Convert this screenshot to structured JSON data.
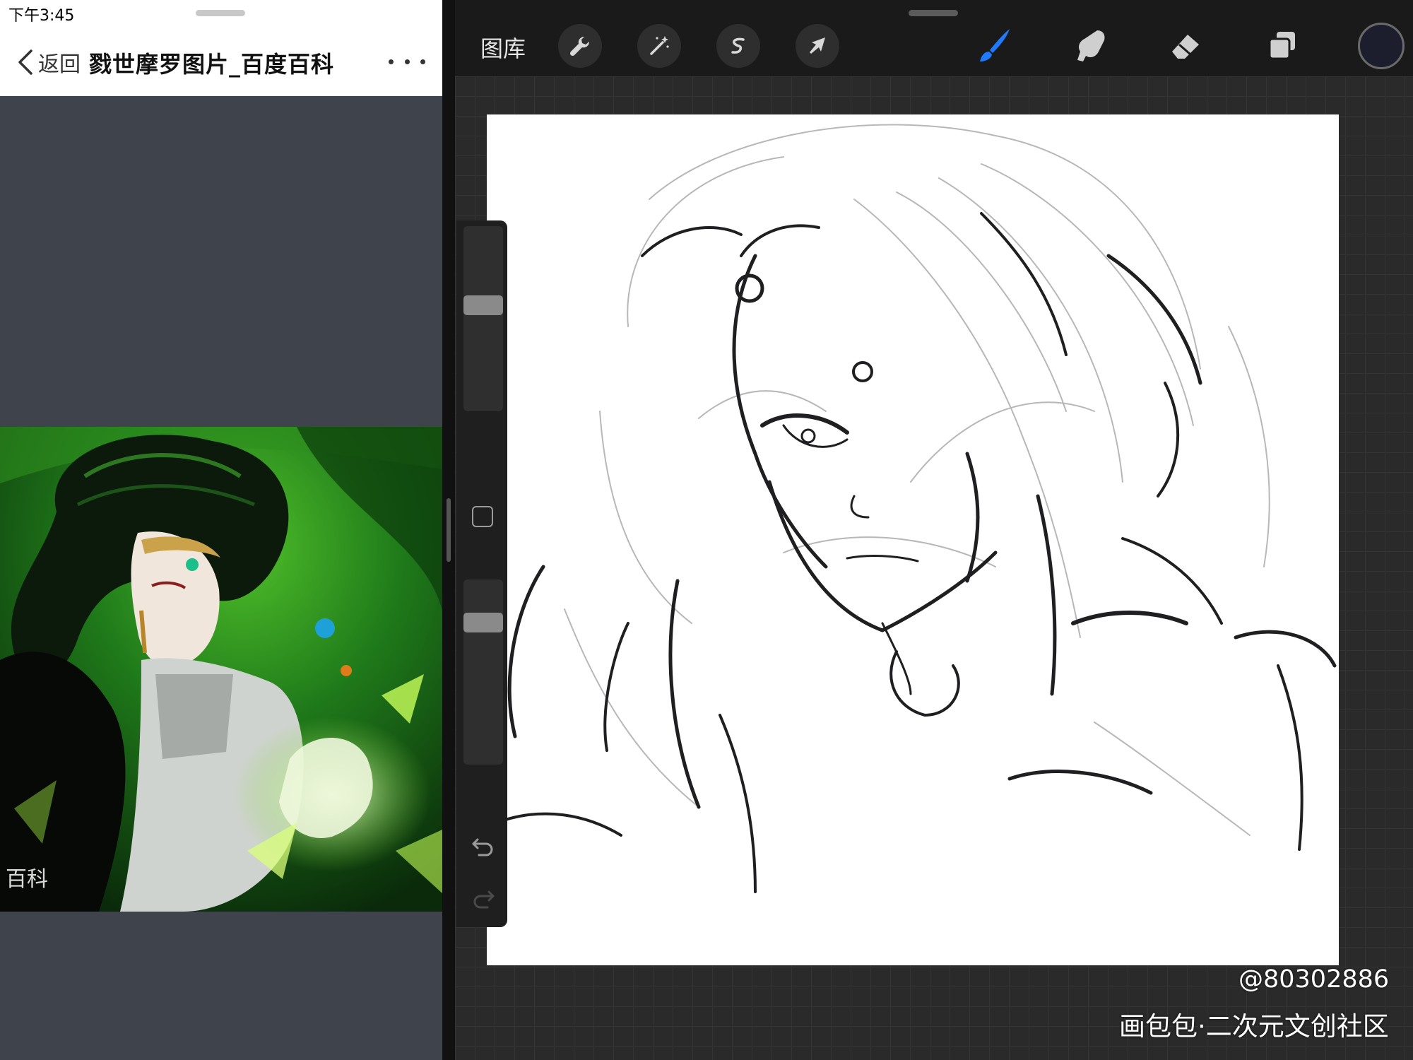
{
  "browser": {
    "status_time": "下午3:45",
    "nav": {
      "back_label": "返回",
      "title": "戮世摩罗图片_百度百科",
      "more_icon": "ellipsis-icon"
    },
    "photo_watermark": "百科"
  },
  "procreate": {
    "toolbar": {
      "gallery_label": "图库",
      "actions_icon": "wrench-icon",
      "adjustments_icon": "magic-wand-icon",
      "selection_icon": "selection-s-icon",
      "transform_icon": "arrow-cursor-icon",
      "brush_icon": "brush-icon",
      "smudge_icon": "smudge-finger-icon",
      "eraser_icon": "eraser-icon",
      "layers_icon": "layers-icon",
      "active_tool": "brush",
      "active_color": "#1c1e2d",
      "accent_color": "#1e7bff"
    },
    "sidebar": {
      "brush_size_level": 0.58,
      "opacity_level": 0.8,
      "undo_icon": "undo-icon",
      "redo_icon": "redo-icon"
    }
  },
  "watermark": {
    "user_id": "@80302886",
    "site": "画包包·二次元文创社区"
  }
}
